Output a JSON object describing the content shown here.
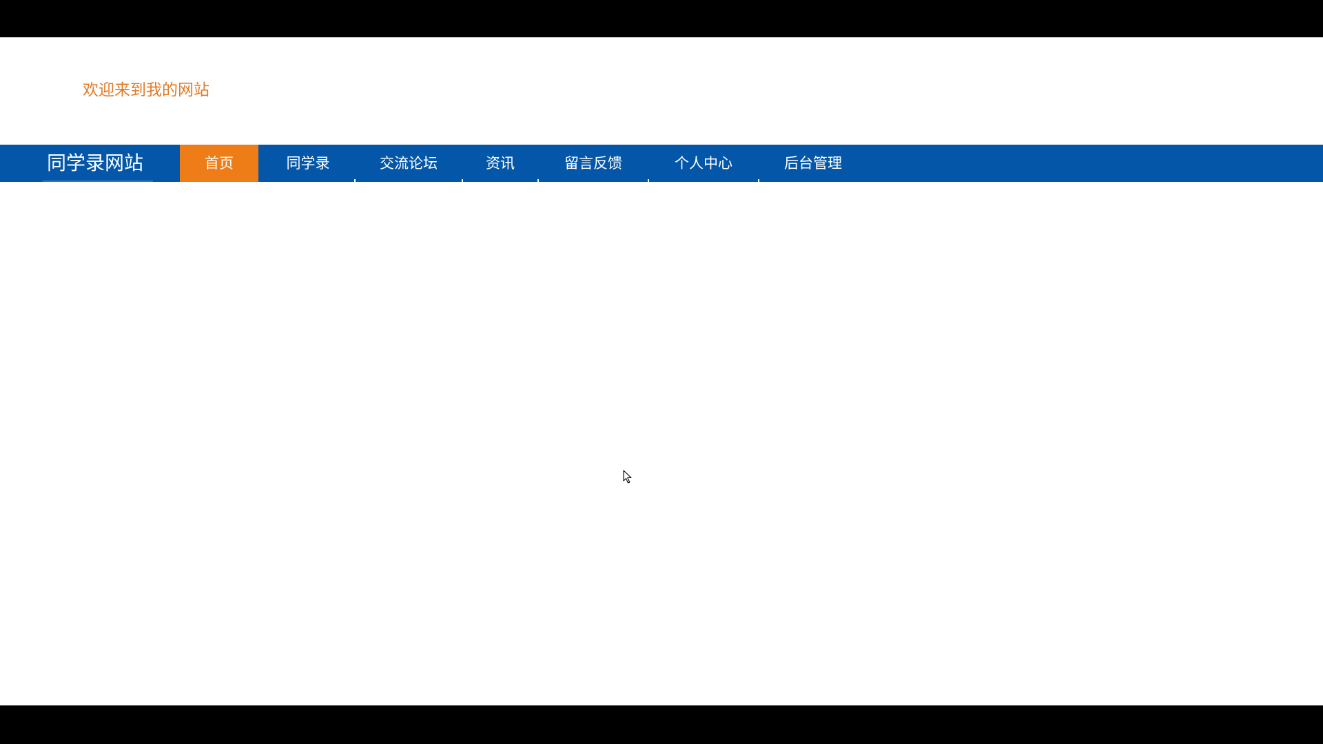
{
  "header": {
    "welcome": "欢迎来到我的网站"
  },
  "navbar": {
    "brand": "同学录网站",
    "items": [
      {
        "label": "首页",
        "active": true
      },
      {
        "label": "同学录",
        "active": false
      },
      {
        "label": "交流论坛",
        "active": false
      },
      {
        "label": "资讯",
        "active": false
      },
      {
        "label": "留言反馈",
        "active": false
      },
      {
        "label": "个人中心",
        "active": false
      },
      {
        "label": "后台管理",
        "active": false
      }
    ]
  },
  "colors": {
    "navbar_bg": "#0457a8",
    "active_bg": "#ee7d17",
    "welcome_text": "#e07b28",
    "nav_text": "#ffffff"
  },
  "icons": {
    "cursor": "mouse-pointer-icon"
  }
}
